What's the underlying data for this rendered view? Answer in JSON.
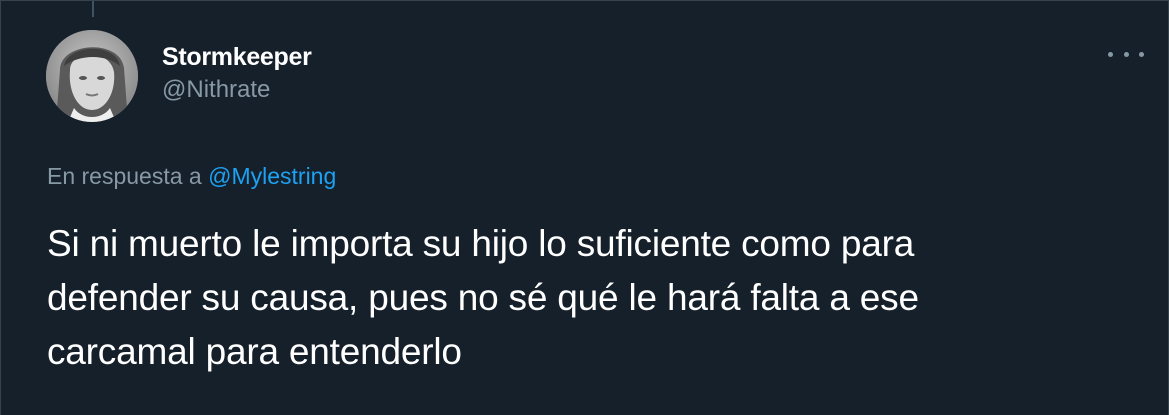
{
  "colors": {
    "background": "#15202b",
    "secondary_text": "#8899a6",
    "accent": "#1da1f2",
    "primary_text": "#ffffff"
  },
  "tweet": {
    "author": {
      "display_name": "Stormkeeper",
      "handle": "@Nithrate",
      "avatar_icon": "profile-photo"
    },
    "more_icon": "more-options-icon",
    "reply_prefix": "En respuesta a",
    "reply_mention": "@Mylestring",
    "text_lines": [
      "Si ni muerto le importa su hijo lo suficiente como para",
      "defender su causa, pues no sé qué le hará falta a ese",
      "carcamal para entenderlo"
    ]
  }
}
